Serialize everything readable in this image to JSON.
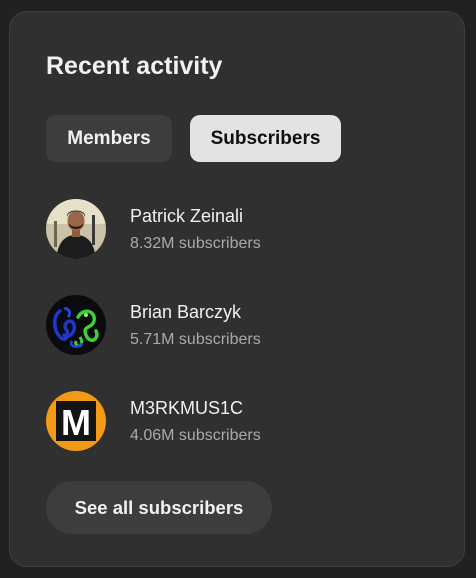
{
  "panel": {
    "title": "Recent activity"
  },
  "tabs": {
    "members_label": "Members",
    "subscribers_label": "Subscribers",
    "selected": "Subscribers"
  },
  "subscribers": [
    {
      "name": "Patrick Zeinali",
      "count": "8.32M subscribers"
    },
    {
      "name": "Brian Barczyk",
      "count": "5.71M subscribers"
    },
    {
      "name": "M3RKMUS1C",
      "count": "4.06M subscribers"
    }
  ],
  "avatars": {
    "third_logo_letter": "M"
  },
  "colors": {
    "card_bg": "#303030",
    "chip_selected_bg": "#e3e3e3",
    "chip_bg": "#3d3d3d",
    "primary_text": "#f1f1f1",
    "secondary_text": "#aaaaaa",
    "brand_orange": "#f29a16"
  },
  "actions": {
    "see_all_label": "See all subscribers"
  }
}
